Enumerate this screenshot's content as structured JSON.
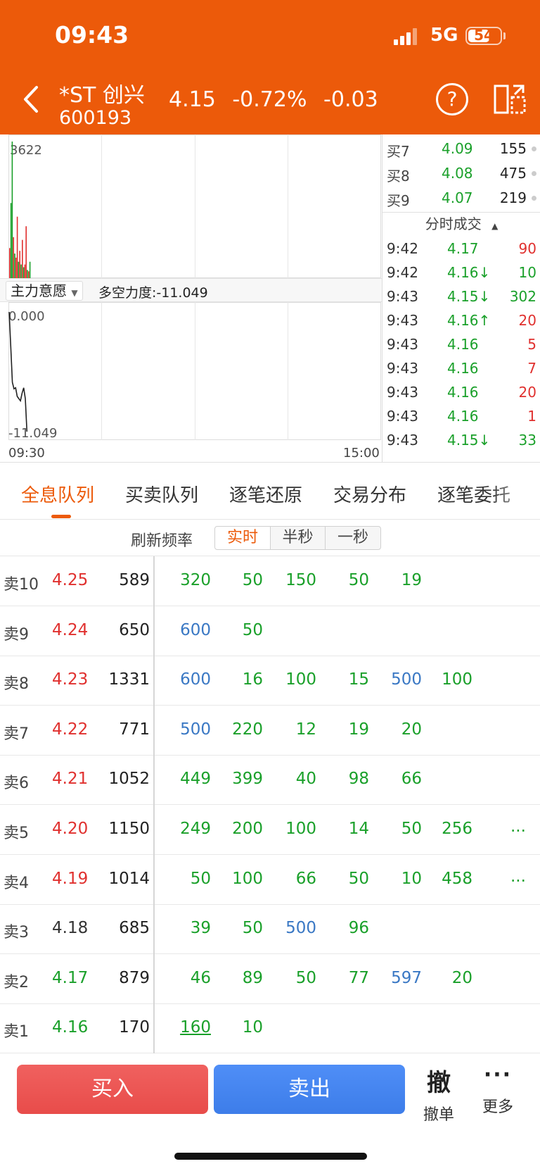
{
  "status_bar": {
    "time": "09:43",
    "network": "5G",
    "battery": "54"
  },
  "header": {
    "name": "*ST 创兴",
    "code": "600193",
    "price": "4.15",
    "change_pct": "-0.72%",
    "change": "-0.03"
  },
  "chart": {
    "volume_max_label": "3622",
    "indicator_name": "主力意愿",
    "indicator_value": "多空力度:-11.049",
    "indicator_top_label": "0.000",
    "indicator_bottom_label": "-11.049",
    "time_start": "09:30",
    "time_end": "15:00",
    "volume_bars": [
      {
        "v": 0.22,
        "c": "r"
      },
      {
        "v": 0.55,
        "c": "g"
      },
      {
        "v": 1.0,
        "c": "g"
      },
      {
        "v": 0.3,
        "c": "r"
      },
      {
        "v": 0.18,
        "c": "g"
      },
      {
        "v": 0.15,
        "c": "r"
      },
      {
        "v": 0.45,
        "c": "r"
      },
      {
        "v": 0.12,
        "c": "g"
      },
      {
        "v": 0.2,
        "c": "r"
      },
      {
        "v": 0.1,
        "c": "g"
      },
      {
        "v": 0.28,
        "c": "r"
      },
      {
        "v": 0.08,
        "c": "g"
      },
      {
        "v": 0.1,
        "c": "r"
      },
      {
        "v": 0.38,
        "c": "r"
      },
      {
        "v": 0.06,
        "c": "g"
      },
      {
        "v": 0.05,
        "c": "r"
      },
      {
        "v": 0.12,
        "c": "g"
      }
    ],
    "indicator_line": [
      0.0,
      -3.2,
      -6.5,
      -7.1,
      -7.0,
      -7.8,
      -8.0,
      -8.2,
      -7.5,
      -7.0,
      -8.0,
      -11.049
    ]
  },
  "bids": [
    {
      "label": "买7",
      "price": "4.09",
      "volume": "155"
    },
    {
      "label": "买8",
      "price": "4.08",
      "volume": "475"
    },
    {
      "label": "买9",
      "price": "4.07",
      "volume": "219"
    }
  ],
  "ticks_header": "分时成交",
  "ticks": [
    {
      "time": "9:42",
      "price": "4.17",
      "volume": "90",
      "color": "#e0302e"
    },
    {
      "time": "9:42",
      "price": "4.16↓",
      "volume": "10",
      "color": "#1aa02a"
    },
    {
      "time": "9:43",
      "price": "4.15↓",
      "volume": "302",
      "color": "#1aa02a"
    },
    {
      "time": "9:43",
      "price": "4.16↑",
      "volume": "20",
      "color": "#e0302e"
    },
    {
      "time": "9:43",
      "price": "4.16",
      "volume": "5",
      "color": "#e0302e"
    },
    {
      "time": "9:43",
      "price": "4.16",
      "volume": "7",
      "color": "#e0302e"
    },
    {
      "time": "9:43",
      "price": "4.16",
      "volume": "20",
      "color": "#e0302e"
    },
    {
      "time": "9:43",
      "price": "4.16",
      "volume": "1",
      "color": "#e0302e"
    },
    {
      "time": "9:43",
      "price": "4.15↓",
      "volume": "33",
      "color": "#1aa02a"
    }
  ],
  "tabs": [
    "全息队列",
    "买卖队列",
    "逐笔还原",
    "交易分布",
    "逐笔委托"
  ],
  "refresh": {
    "label": "刷新频率",
    "options": [
      "实时",
      "半秒",
      "一秒"
    ]
  },
  "queue": [
    {
      "label": "卖10",
      "price": "4.25",
      "pcolor": "#e0302e",
      "volume": "589",
      "orders": [
        [
          "320",
          "g"
        ],
        [
          "50",
          "g"
        ],
        [
          "150",
          "g"
        ],
        [
          "50",
          "g"
        ],
        [
          "19",
          "g"
        ]
      ],
      "more": ""
    },
    {
      "label": "卖9",
      "price": "4.24",
      "pcolor": "#e0302e",
      "volume": "650",
      "orders": [
        [
          "600",
          "b"
        ],
        [
          "50",
          "g"
        ]
      ],
      "more": ""
    },
    {
      "label": "卖8",
      "price": "4.23",
      "pcolor": "#e0302e",
      "volume": "1331",
      "orders": [
        [
          "600",
          "b"
        ],
        [
          "16",
          "g"
        ],
        [
          "100",
          "g"
        ],
        [
          "15",
          "g"
        ],
        [
          "500",
          "b"
        ],
        [
          "100",
          "g"
        ]
      ],
      "more": ""
    },
    {
      "label": "卖7",
      "price": "4.22",
      "pcolor": "#e0302e",
      "volume": "771",
      "orders": [
        [
          "500",
          "b"
        ],
        [
          "220",
          "g"
        ],
        [
          "12",
          "g"
        ],
        [
          "19",
          "g"
        ],
        [
          "20",
          "g"
        ]
      ],
      "more": ""
    },
    {
      "label": "卖6",
      "price": "4.21",
      "pcolor": "#e0302e",
      "volume": "1052",
      "orders": [
        [
          "449",
          "g"
        ],
        [
          "399",
          "g"
        ],
        [
          "40",
          "g"
        ],
        [
          "98",
          "g"
        ],
        [
          "66",
          "g"
        ]
      ],
      "more": ""
    },
    {
      "label": "卖5",
      "price": "4.20",
      "pcolor": "#e0302e",
      "volume": "1150",
      "orders": [
        [
          "249",
          "g"
        ],
        [
          "200",
          "g"
        ],
        [
          "100",
          "g"
        ],
        [
          "14",
          "g"
        ],
        [
          "50",
          "g"
        ],
        [
          "256",
          "g"
        ]
      ],
      "more": "..."
    },
    {
      "label": "卖4",
      "price": "4.19",
      "pcolor": "#e0302e",
      "volume": "1014",
      "orders": [
        [
          "50",
          "g"
        ],
        [
          "100",
          "g"
        ],
        [
          "66",
          "g"
        ],
        [
          "50",
          "g"
        ],
        [
          "10",
          "g"
        ],
        [
          "458",
          "g"
        ]
      ],
      "more": "..."
    },
    {
      "label": "卖3",
      "price": "4.18",
      "pcolor": "#333333",
      "volume": "685",
      "orders": [
        [
          "39",
          "g"
        ],
        [
          "50",
          "g"
        ],
        [
          "500",
          "b"
        ],
        [
          "96",
          "g"
        ]
      ],
      "more": ""
    },
    {
      "label": "卖2",
      "price": "4.17",
      "pcolor": "#1aa02a",
      "volume": "879",
      "orders": [
        [
          "46",
          "g"
        ],
        [
          "89",
          "g"
        ],
        [
          "50",
          "g"
        ],
        [
          "77",
          "g"
        ],
        [
          "597",
          "b"
        ],
        [
          "20",
          "g"
        ]
      ],
      "more": ""
    },
    {
      "label": "卖1",
      "price": "4.16",
      "pcolor": "#1aa02a",
      "volume": "170",
      "orders": [
        [
          "160",
          "gu"
        ],
        [
          "10",
          "g"
        ]
      ],
      "more": ""
    }
  ],
  "actions": {
    "buy": "买入",
    "sell": "卖出",
    "cancel_glyph": "撤",
    "cancel_label": "撤单",
    "more_label": "更多"
  }
}
